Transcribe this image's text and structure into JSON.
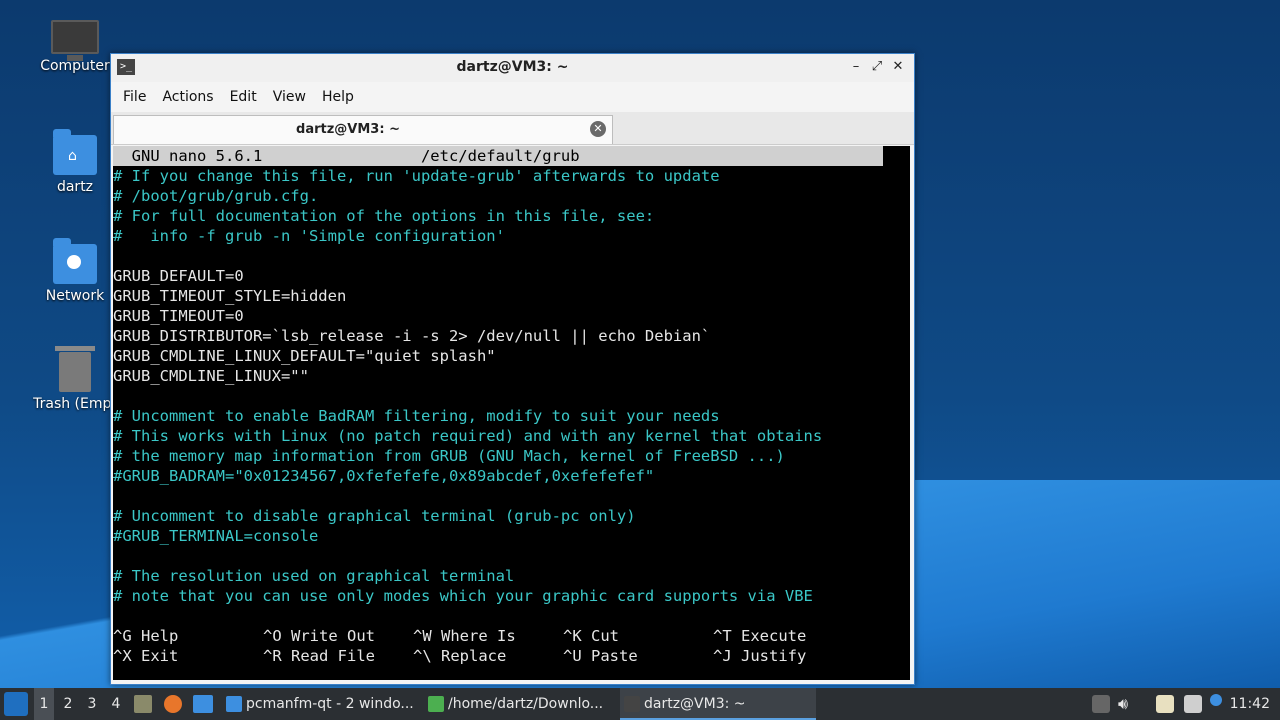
{
  "desktop": {
    "icons": [
      {
        "label": "Computer",
        "icon": "computer-icon"
      },
      {
        "label": "dartz",
        "icon": "home-folder-icon"
      },
      {
        "label": "Network",
        "icon": "network-folder-icon"
      },
      {
        "label": "Trash (Empt",
        "icon": "trash-icon"
      }
    ]
  },
  "window": {
    "title": "dartz@VM3: ~",
    "app_icon_glyph": ">_",
    "controls": {
      "minimize": "–",
      "maximize": "⤢",
      "close": "✕"
    },
    "menu": [
      "File",
      "Actions",
      "Edit",
      "View",
      "Help"
    ],
    "tab": {
      "label": "dartz@VM3: ~",
      "close": "✕"
    }
  },
  "nano": {
    "header": "  GNU nano 5.6.1                 /etc/default/grub                           ",
    "lines": [
      {
        "text": "# If you change this file, run 'update-grub' afterwards to update",
        "comment": true
      },
      {
        "text": "# /boot/grub/grub.cfg.",
        "comment": true
      },
      {
        "text": "# For full documentation of the options in this file, see:",
        "comment": true
      },
      {
        "text": "#   info -f grub -n 'Simple configuration'",
        "comment": true
      },
      {
        "text": "",
        "comment": false
      },
      {
        "text": "GRUB_DEFAULT=0",
        "comment": false
      },
      {
        "text": "GRUB_TIMEOUT_STYLE=hidden",
        "comment": false
      },
      {
        "text": "GRUB_TIMEOUT=0",
        "comment": false
      },
      {
        "text": "GRUB_DISTRIBUTOR=`lsb_release -i -s 2> /dev/null || echo Debian`",
        "comment": false
      },
      {
        "text": "GRUB_CMDLINE_LINUX_DEFAULT=\"quiet splash\"",
        "comment": false
      },
      {
        "text": "GRUB_CMDLINE_LINUX=\"\"",
        "comment": false
      },
      {
        "text": "",
        "comment": false
      },
      {
        "text": "# Uncomment to enable BadRAM filtering, modify to suit your needs",
        "comment": true
      },
      {
        "text": "# This works with Linux (no patch required) and with any kernel that obtains",
        "comment": true
      },
      {
        "text": "# the memory map information from GRUB (GNU Mach, kernel of FreeBSD ...)",
        "comment": true
      },
      {
        "text": "#GRUB_BADRAM=\"0x01234567,0xfefefefe,0x89abcdef,0xefefefef\"",
        "comment": true
      },
      {
        "text": "",
        "comment": false
      },
      {
        "text": "# Uncomment to disable graphical terminal (grub-pc only)",
        "comment": true
      },
      {
        "text": "#GRUB_TERMINAL=console",
        "comment": true
      },
      {
        "text": "",
        "comment": false
      },
      {
        "text": "# The resolution used on graphical terminal",
        "comment": true
      },
      {
        "text": "# note that you can use only modes which your graphic card supports via VBE",
        "comment": true
      }
    ],
    "shortcuts": [
      [
        {
          "key": "^G",
          "label": "Help"
        },
        {
          "key": "^O",
          "label": "Write Out"
        },
        {
          "key": "^W",
          "label": "Where Is"
        },
        {
          "key": "^K",
          "label": "Cut"
        },
        {
          "key": "^T",
          "label": "Execute"
        }
      ],
      [
        {
          "key": "^X",
          "label": "Exit"
        },
        {
          "key": "^R",
          "label": "Read File"
        },
        {
          "key": "^\\",
          "label": "Replace"
        },
        {
          "key": "^U",
          "label": "Paste"
        },
        {
          "key": "^J",
          "label": "Justify"
        }
      ]
    ]
  },
  "taskbar": {
    "desktops": [
      "1",
      "2",
      "3",
      "4"
    ],
    "active_desktop": "1",
    "tasks": [
      {
        "label": "pcmanfm-qt - 2 windo...",
        "icon": "folder-icon",
        "color": "#3d8fe0",
        "active": false
      },
      {
        "label": "/home/dartz/Downlo...",
        "icon": "archive-icon",
        "color": "#4caf50",
        "active": false
      },
      {
        "label": "dartz@VM3: ~",
        "icon": "terminal-icon",
        "color": "#444444",
        "active": true
      }
    ],
    "clock": "11:42"
  }
}
